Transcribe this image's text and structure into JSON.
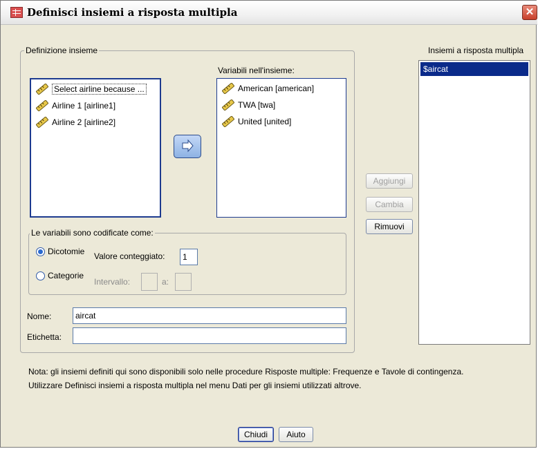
{
  "window": {
    "title": "Definisci insiemi a risposta multipla",
    "close_glyph": "✕"
  },
  "definition_group": {
    "legend": "Definizione insieme"
  },
  "source_list": {
    "items": [
      {
        "label": "Select airline because ...",
        "icon": "ruler-icon",
        "selected": true
      },
      {
        "label": "Airline 1 [airline1]",
        "icon": "ruler-icon",
        "selected": false
      },
      {
        "label": "Airline 2 [airline2]",
        "icon": "ruler-icon",
        "selected": false
      }
    ]
  },
  "set_variables": {
    "label": "Variabili nell'insieme:",
    "items": [
      {
        "label": "American [american]",
        "icon": "ruler-icon"
      },
      {
        "label": "TWA [twa]",
        "icon": "ruler-icon"
      },
      {
        "label": "United [united]",
        "icon": "ruler-icon"
      }
    ]
  },
  "move_button": {
    "icon": "arrow-right-icon"
  },
  "coding_group": {
    "legend": "Le variabili sono codificate come:",
    "dichotomies_label": "Dicotomie",
    "counted_value_label": "Valore conteggiato:",
    "counted_value": "1",
    "categories_label": "Categorie",
    "range_label": "Intervallo:",
    "range_a_label": "a:",
    "range_from": "",
    "range_to": "",
    "selected": "dichotomies"
  },
  "name_field": {
    "label": "Nome:",
    "value": "aircat"
  },
  "label_field": {
    "label": "Etichetta:",
    "value": ""
  },
  "actions": {
    "add": "Aggiungi",
    "change": "Cambia",
    "remove": "Rimuovi"
  },
  "sets_list": {
    "label": "Insiemi a risposta multipla",
    "items": [
      "$aircat"
    ]
  },
  "note": {
    "line1": "Nota: gli insiemi definiti qui sono disponibili solo nelle procedure Risposte multiple: Frequenze e Tavole di contingenza.",
    "line2": "Utilizzare Definisci insiemi a risposta multipla nel menu Dati per gli insiemi utilizzati altrove."
  },
  "footer": {
    "close": "Chiudi",
    "help": "Aiuto"
  }
}
